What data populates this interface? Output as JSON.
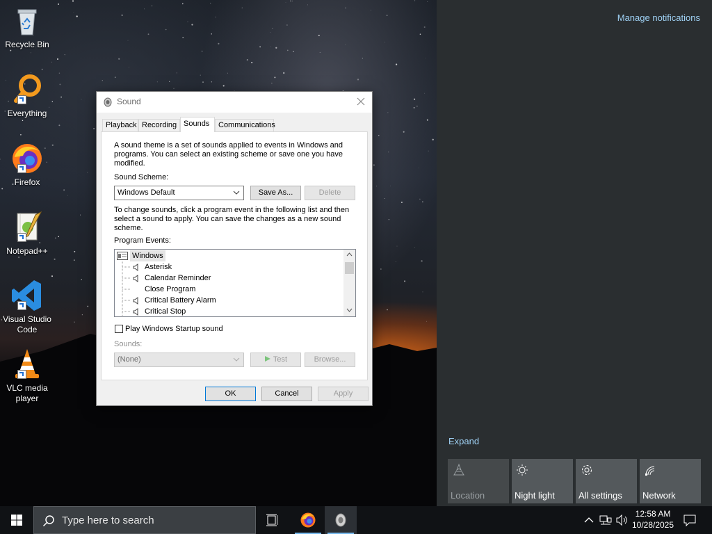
{
  "desktop": {
    "icons": [
      {
        "label": "Recycle Bin"
      },
      {
        "label": "Everything"
      },
      {
        "label": "Firefox"
      },
      {
        "label": "Notepad++"
      },
      {
        "label": "Visual Studio Code"
      },
      {
        "label": "VLC media player"
      }
    ]
  },
  "sound_dialog": {
    "title": "Sound",
    "tabs": [
      "Playback",
      "Recording",
      "Sounds",
      "Communications"
    ],
    "selected_tab": "Sounds",
    "intro_text": "A sound theme is a set of sounds applied to events in Windows and programs.  You can select an existing scheme or save one you have modified.",
    "scheme_label": "Sound Scheme:",
    "scheme_value": "Windows Default",
    "save_as_label": "Save As...",
    "delete_label": "Delete",
    "change_text": "To change sounds, click a program event in the following list and then select a sound to apply.  You can save the changes as a new sound scheme.",
    "program_events_label": "Program Events:",
    "events": [
      {
        "label": "Windows",
        "group": true
      },
      {
        "label": "Asterisk",
        "has_sound": true
      },
      {
        "label": "Calendar Reminder",
        "has_sound": true
      },
      {
        "label": "Close Program",
        "has_sound": false
      },
      {
        "label": "Critical Battery Alarm",
        "has_sound": true
      },
      {
        "label": "Critical Stop",
        "has_sound": true
      }
    ],
    "startup_sound_label": "Play Windows Startup sound",
    "startup_sound_checked": false,
    "sounds_label": "Sounds:",
    "sounds_value": "(None)",
    "test_label": "Test",
    "browse_label": "Browse...",
    "ok_label": "OK",
    "cancel_label": "Cancel",
    "apply_label": "Apply"
  },
  "action_center": {
    "manage_notifications": "Manage notifications",
    "expand": "Expand",
    "quick_actions": [
      {
        "label": "Location",
        "icon": "location-icon",
        "enabled": false
      },
      {
        "label": "Night light",
        "icon": "night-light-icon",
        "enabled": true
      },
      {
        "label": "All settings",
        "icon": "settings-gear-icon",
        "enabled": true
      },
      {
        "label": "Network",
        "icon": "network-icon",
        "enabled": true
      }
    ]
  },
  "taskbar": {
    "search_placeholder": "Type here to search",
    "time": "12:58 AM",
    "date": "10/28/2025"
  },
  "colors": {
    "link": "#9fd1f4",
    "taskbar": "#101215",
    "action_center": "#2a2e30",
    "tile": "#54595c",
    "accent_underline": "#76b9ed"
  }
}
